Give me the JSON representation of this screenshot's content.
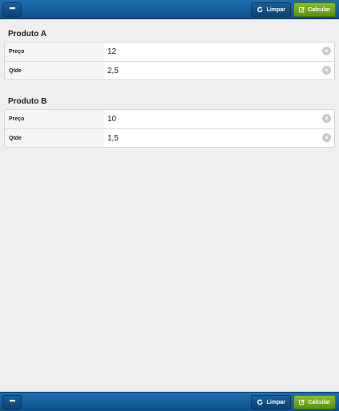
{
  "toolbar": {
    "menu_label": "•••",
    "limpar_label": "Limpar",
    "calcular_label": "Calcular"
  },
  "products": [
    {
      "title": "Produto A",
      "rows": [
        {
          "label": "Preço",
          "value": "12"
        },
        {
          "label": "Qtde",
          "value": "2,5"
        }
      ]
    },
    {
      "title": "Produto B",
      "rows": [
        {
          "label": "Preço",
          "value": "10"
        },
        {
          "label": "Qtde",
          "value": "1,5"
        }
      ]
    }
  ],
  "colors": {
    "toolbar": "#1565a6",
    "calcular": "#7ab020",
    "background": "#efefef"
  },
  "icons": {
    "limpar": "refresh-icon",
    "calcular": "edit-icon",
    "clear": "clear-icon"
  }
}
